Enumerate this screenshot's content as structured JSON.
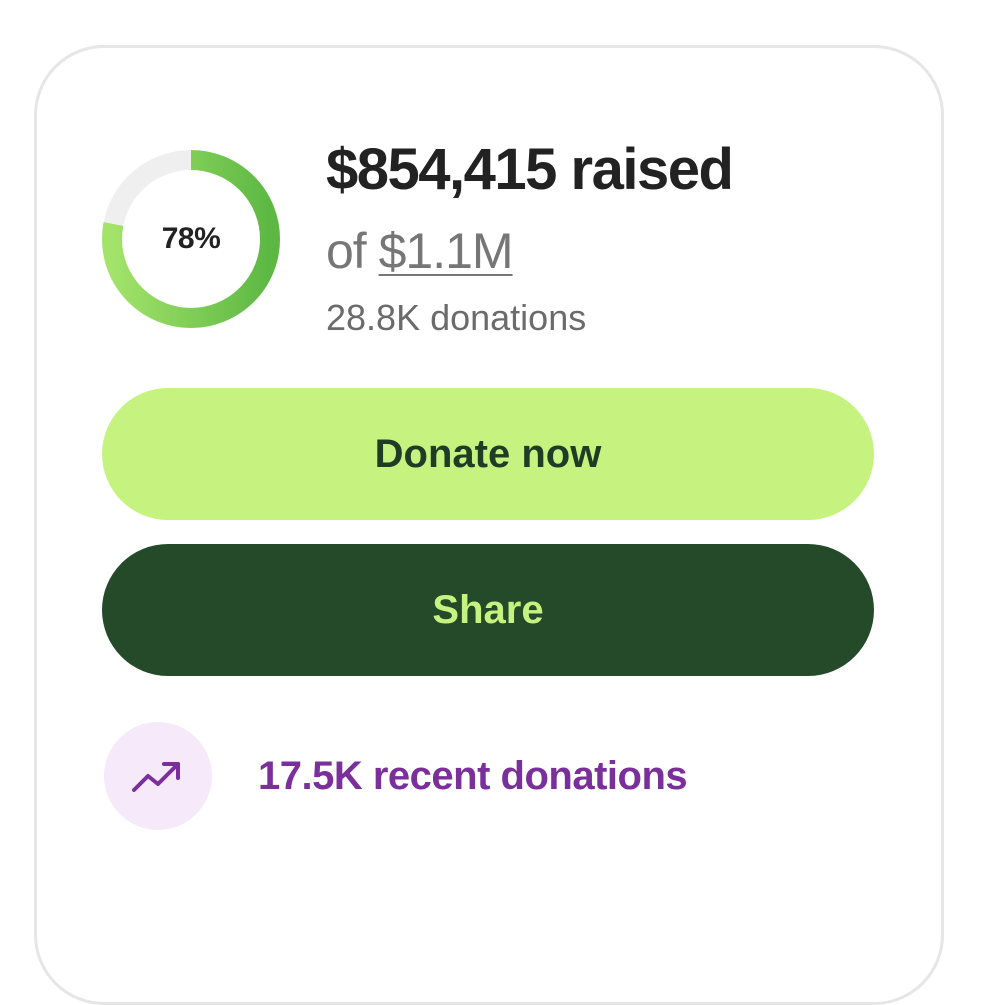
{
  "progress": {
    "percent_label": "78%",
    "fraction": 0.78,
    "track_color": "#efefef",
    "fill_color": "#6cc24a"
  },
  "summary": {
    "raised_label": "$854,415 raised",
    "goal_prefix": "of ",
    "goal_amount": "$1.1M",
    "donation_count": "28.8K donations"
  },
  "actions": {
    "donate_label": "Donate now",
    "share_label": "Share"
  },
  "recent": {
    "icon": "trending-up-icon",
    "label": "17.5K recent donations"
  },
  "colors": {
    "donate_bg": "#c6f37f",
    "share_bg": "#244a2a",
    "accent_purple": "#7a2f9a"
  }
}
